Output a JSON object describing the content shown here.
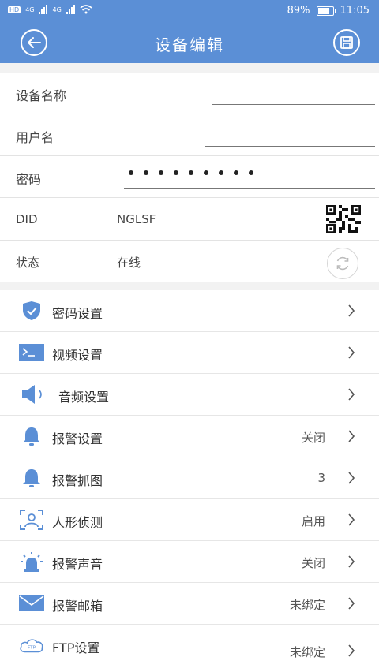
{
  "status_bar": {
    "sim_label": "HD",
    "network1": "4G",
    "network2": "4G",
    "battery": "89%",
    "battery_level": 0.89,
    "time": "11:05"
  },
  "header": {
    "title": "设备编辑"
  },
  "form": {
    "device_name_label": "设备名称",
    "username_label": "用户名",
    "password_label": "密码",
    "did_label": "DID",
    "did_value": "NGLSF",
    "status_label": "状态",
    "status_value": "在线"
  },
  "settings": [
    {
      "label": "密码设置",
      "value": "",
      "icon": "shield-icon"
    },
    {
      "label": "视频设置",
      "value": "",
      "icon": "video-terminal-icon"
    },
    {
      "label": "音频设置",
      "value": "",
      "icon": "speaker-icon"
    },
    {
      "label": "报警设置",
      "value": "关闭",
      "icon": "bell-icon"
    },
    {
      "label": "报警抓图",
      "value": "3",
      "icon": "bell-icon"
    },
    {
      "label": "人形侦测",
      "value": "启用",
      "icon": "human-detect-icon"
    },
    {
      "label": "报警声音",
      "value": "关闭",
      "icon": "siren-icon"
    },
    {
      "label": "报警邮箱",
      "value": "未绑定",
      "icon": "mail-icon"
    },
    {
      "label": "FTP设置",
      "value": "未绑定",
      "icon": "ftp-cloud-icon"
    }
  ],
  "colors": {
    "accent": "#5b8fd6",
    "background": "#f2f2f2"
  }
}
